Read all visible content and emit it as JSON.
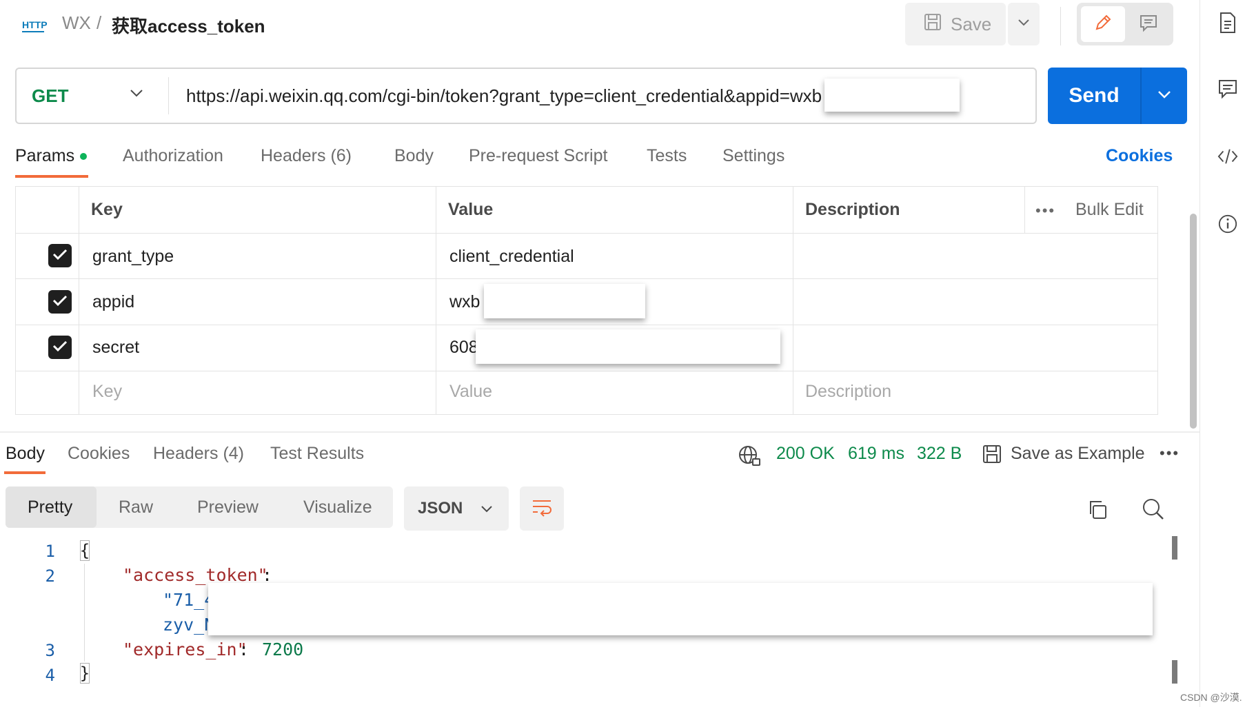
{
  "header": {
    "breadcrumb_parent": "WX",
    "breadcrumb_sep": "/",
    "title": "获取access_token",
    "save_label": "Save",
    "icon_text": "HTTP"
  },
  "request": {
    "method": "GET",
    "url": "https://api.weixin.qq.com/cgi-bin/token?grant_type=client_credential&appid=wxb                                          0&secr...",
    "send_label": "Send",
    "tabs": [
      {
        "label": "Params"
      },
      {
        "label": "Authorization"
      },
      {
        "label": "Headers (6)"
      },
      {
        "label": "Body"
      },
      {
        "label": "Pre-request Script"
      },
      {
        "label": "Tests"
      },
      {
        "label": "Settings"
      }
    ],
    "cookies_label": "Cookies"
  },
  "params": {
    "columns": {
      "key": "Key",
      "value": "Value",
      "description": "Description",
      "bulk_edit": "Bulk Edit",
      "more": "•••"
    },
    "rows": [
      {
        "key": "grant_type",
        "value": "client_credential",
        "checked": true
      },
      {
        "key": "appid",
        "value": "wxb",
        "checked": true
      },
      {
        "key": "secret",
        "value": "608",
        "checked": true
      }
    ],
    "placeholder": {
      "key": "Key",
      "value": "Value",
      "description": "Description"
    }
  },
  "response": {
    "tabs": [
      {
        "label": "Body"
      },
      {
        "label": "Cookies"
      },
      {
        "label": "Headers (4)"
      },
      {
        "label": "Test Results"
      }
    ],
    "status": "200 OK",
    "time": "619 ms",
    "size": "322 B",
    "save_example": "Save as Example",
    "more": "•••",
    "view_modes": [
      "Pretty",
      "Raw",
      "Preview",
      "Visualize"
    ],
    "format": "JSON",
    "lines": [
      "1",
      "2",
      "3",
      "4"
    ],
    "code": {
      "open": "{",
      "key1": "\"access_token\"",
      "colon1": ":",
      "val1_start": "\"71_4",
      "val1_cont": "zyv_N",
      "key2": "\"expires_in\"",
      "colon2": ": ",
      "val2": "7200",
      "close": "}"
    }
  },
  "watermark": "CSDN @沙漠."
}
